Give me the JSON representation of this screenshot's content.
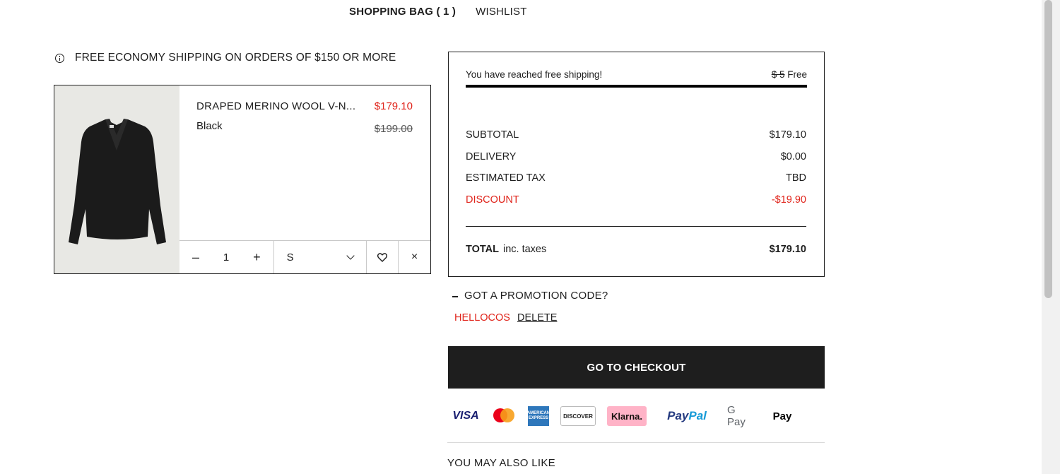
{
  "tabs": {
    "bag": "SHOPPING BAG ( 1 )",
    "wishlist": "WISHLIST"
  },
  "shipping_note": "FREE ECONOMY SHIPPING ON ORDERS OF $150 OR MORE",
  "product": {
    "name": "DRAPED MERINO WOOL V-N...",
    "color": "Black",
    "price": "$179.10",
    "original_price": "$199.00",
    "quantity": "1",
    "decrement": "–",
    "increment": "+",
    "size": "S",
    "close": "×"
  },
  "summary": {
    "free_shipping_msg": "You have reached free shipping!",
    "shipping_old": "$ 5",
    "shipping_new": "Free",
    "free_shipping_progress": 1.0,
    "rows": [
      {
        "label": "SUBTOTAL",
        "value": "$179.10"
      },
      {
        "label": "DELIVERY",
        "value": "$0.00"
      },
      {
        "label": "ESTIMATED TAX",
        "value": "TBD"
      },
      {
        "label": "DISCOUNT",
        "value": "-$19.90"
      }
    ],
    "total_label": "TOTAL",
    "total_sub": "inc. taxes",
    "total_value": "$179.10"
  },
  "promo": {
    "question": "GOT A PROMOTION CODE?",
    "code": "HELLOCOS",
    "delete": "DELETE"
  },
  "checkout_label": "GO TO CHECKOUT",
  "payments": {
    "visa": "VISA",
    "amex": "AMERICAN EXPRESS",
    "discover": "DISCOVER",
    "klarna": "Klarna.",
    "paypal_1": "Pay",
    "paypal_2": "Pal",
    "gpay": "G Pay",
    "apay": " Pay"
  },
  "recommend_title": "YOU MAY ALSO LIKE",
  "colors": {
    "accent_red": "#e0241b",
    "dark": "#1e1e1e"
  }
}
